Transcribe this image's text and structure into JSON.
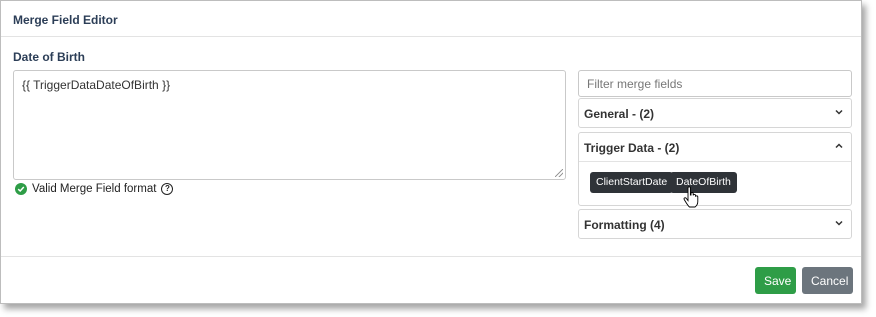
{
  "dialog": {
    "title": "Merge Field Editor",
    "field_label": "Date of Birth",
    "textarea_value": "{{ TriggerDataDateOfBirth }}",
    "validation_text": "Valid Merge Field format",
    "filter_placeholder": "Filter merge fields",
    "groups": [
      {
        "label": "General - (2)",
        "expanded": false,
        "icon": "chevron-down-icon"
      },
      {
        "label": "Trigger Data - (2)",
        "expanded": true,
        "icon": "chevron-up-icon",
        "fields": [
          "ClientStartDate",
          "DateOfBirth"
        ]
      },
      {
        "label": "Formatting (4)",
        "expanded": false,
        "icon": "chevron-down-icon"
      }
    ],
    "save_label": "Save",
    "cancel_label": "Cancel"
  },
  "colors": {
    "title": "#2c3e57",
    "save": "#2e9d47",
    "cancel": "#6c757d",
    "tag": "#2f3338",
    "valid": "#2e9d47"
  }
}
